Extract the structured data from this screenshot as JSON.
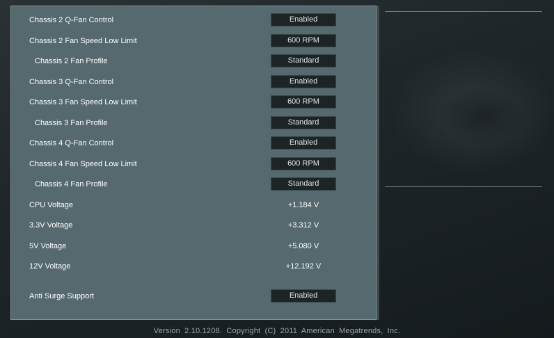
{
  "rows": [
    {
      "label": "Chassis 2 Q-Fan Control",
      "value": "Enabled",
      "kind": "button"
    },
    {
      "label": "Chassis 2 Fan Speed Low Limit",
      "value": "600 RPM",
      "kind": "button"
    },
    {
      "label": "Chassis 2 Fan Profile",
      "value": "Standard",
      "kind": "button"
    },
    {
      "label": "Chassis 3 Q-Fan Control",
      "value": "Enabled",
      "kind": "button"
    },
    {
      "label": "Chassis 3 Fan Speed Low Limit",
      "value": "600 RPM",
      "kind": "button"
    },
    {
      "label": "Chassis 3 Fan Profile",
      "value": "Standard",
      "kind": "button"
    },
    {
      "label": "Chassis 4 Q-Fan Control",
      "value": "Enabled",
      "kind": "button"
    },
    {
      "label": "Chassis 4 Fan Speed Low Limit",
      "value": "600 RPM",
      "kind": "button"
    },
    {
      "label": "Chassis 4 Fan Profile",
      "value": "Standard",
      "kind": "button"
    },
    {
      "label": "CPU Voltage",
      "value": "+1.184 V",
      "kind": "readout"
    },
    {
      "label": "3.3V Voltage",
      "value": "+3.312 V",
      "kind": "readout"
    },
    {
      "label": "5V Voltage",
      "value": "+5.080 V",
      "kind": "readout"
    },
    {
      "label": "12V Voltage",
      "value": "+12.192 V",
      "kind": "readout"
    },
    {
      "label": "Anti Surge Support",
      "value": "Enabled",
      "kind": "button"
    }
  ],
  "footer": {
    "text": "Version 2.10.1208. Copyright (C) 2011 American Megatrends, Inc."
  },
  "colors": {
    "panel": "#56696f",
    "button": "#1d2426",
    "background": "#1f2629",
    "footer_text": "#9aa6aa"
  }
}
